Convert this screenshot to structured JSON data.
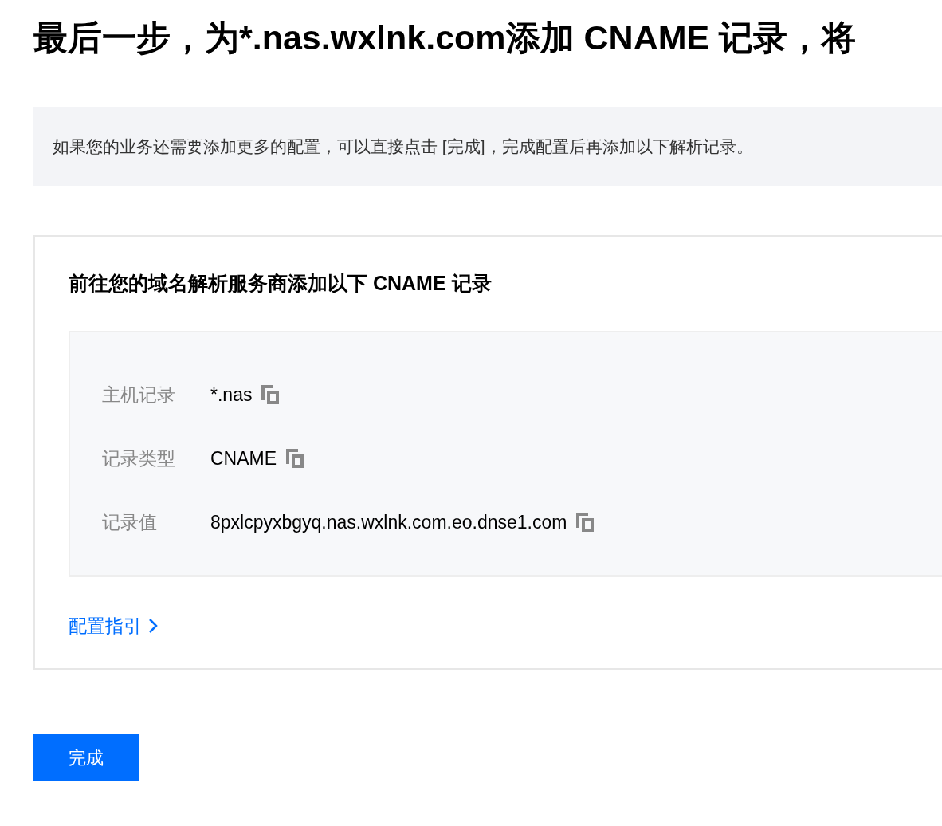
{
  "title": "最后一步，为*.nas.wxlnk.com添加 CNAME 记录，将",
  "notice": "如果您的业务还需要添加更多的配置，可以直接点击 [完成]，完成配置后再添加以下解析记录。",
  "card": {
    "title": "前往您的域名解析服务商添加以下 CNAME 记录",
    "records": [
      {
        "label": "主机记录",
        "value": "*.nas"
      },
      {
        "label": "记录类型",
        "value": "CNAME"
      },
      {
        "label": "记录值",
        "value": "8pxlcpyxbgyq.nas.wxlnk.com.eo.dnse1.com"
      }
    ],
    "guide_link": "配置指引"
  },
  "button": "完成"
}
